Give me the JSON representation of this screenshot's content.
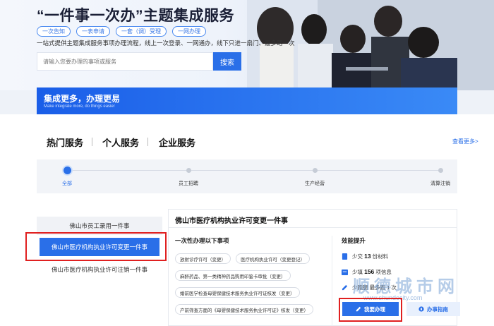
{
  "hero": {
    "title": "“一件事一次办”主题集成服务",
    "tags": [
      "一次告知",
      "一表申请",
      "一套（调）受理",
      "一网办理"
    ],
    "description": "一站式提供主题集成服务事项办理流程，线上一次登录、一网通办，线下只进一扇门、最多跑一次",
    "search_placeholder": "请输入您要办理的事项或服务",
    "search_button": "搜索"
  },
  "banner": {
    "title": "集成更多，办理更易",
    "subtitle": "Make integrate more, do things easier"
  },
  "tabs": [
    "热门服务",
    "个人服务",
    "企业服务"
  ],
  "more_link": "查看更多>",
  "timeline": [
    "全部",
    "员工招聘",
    "生产经营",
    "清算注销"
  ],
  "left_list": [
    "佛山市员工录用一件事",
    "佛山市医疗机构执业许可变更一件事",
    "佛山市医疗机构执业许可注销一件事"
  ],
  "panel": {
    "title": "佛山市医疗机构执业许可变更一件事",
    "section_left": "一次性办理以下事项",
    "items": [
      "放射诊疗许可（变更）",
      "医疗机构执业许可（变更登记）",
      "麻醉药品、第一类精神药品购用印鉴卡审批（变更）",
      "婚前医学检查母婴保健技术服务执业许可证核发（变更）",
      "产前筛查方面的《母婴保健技术服务执业许可证》核发（变更）"
    ],
    "section_right": "效能提升",
    "eff_1": {
      "prefix": "少交",
      "num": "13",
      "suffix": "份材料"
    },
    "eff_2": {
      "prefix": "少填",
      "num": "156",
      "suffix": "项信息"
    },
    "eff_3": "少跑腿 最多跑 1 次",
    "btn_apply": "我要办理",
    "btn_guide": "办事指南"
  },
  "watermark": {
    "cn": "顺德城市网",
    "url": "www.shundecity.com"
  },
  "colors": {
    "primary": "#2a6fe8",
    "highlight": "#e02020"
  }
}
